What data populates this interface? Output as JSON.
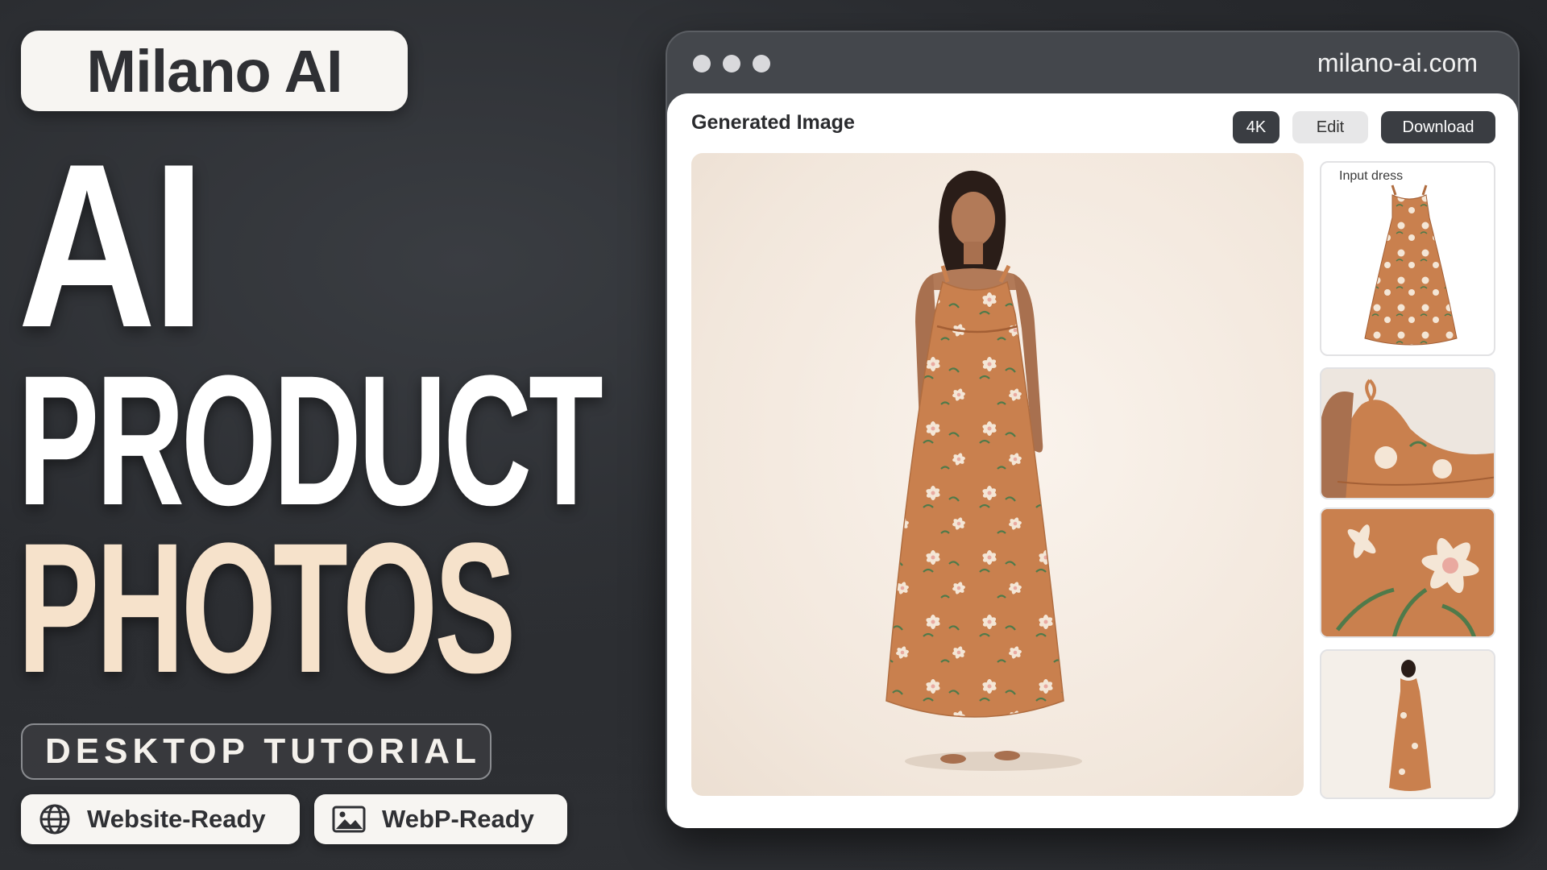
{
  "brand": {
    "name": "Milano AI"
  },
  "headline": {
    "line1": "AI",
    "line2": "PRODUCT",
    "line3": "PHOTOS"
  },
  "tutorial_label": "DESKTOP TUTORIAL",
  "features": [
    {
      "label": "Website-Ready",
      "icon": "globe-icon"
    },
    {
      "label": "WebP-Ready",
      "icon": "image-icon"
    }
  ],
  "browser": {
    "url": "milano-ai.com",
    "content_title": "Generated Image",
    "buttons": {
      "resolution_label": "4K",
      "edit_label": "Edit",
      "download_label": "Download"
    },
    "thumbnails": [
      {
        "label": "Input dress"
      }
    ]
  },
  "colors": {
    "background": "#2a2c30",
    "headline_accent": "#f6e2cb",
    "dress": "#c9804e",
    "button_dark": "#3a3d42"
  }
}
